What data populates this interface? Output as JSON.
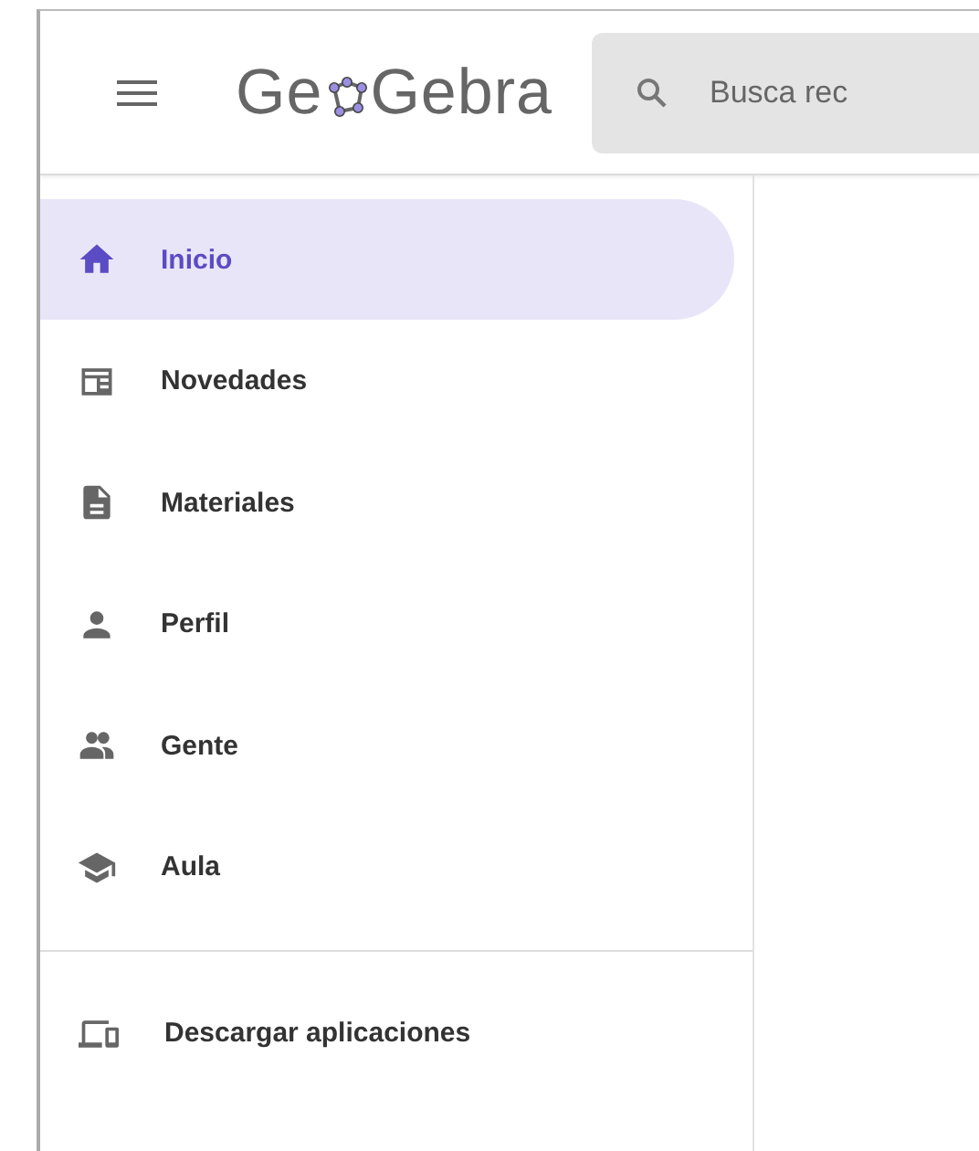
{
  "header": {
    "logo": {
      "before": "Ge",
      "after": "Gebra"
    },
    "search": {
      "placeholder": "Busca rec"
    }
  },
  "sidebar": {
    "items": [
      {
        "kind": "home",
        "label": "Inicio",
        "selected": true
      },
      {
        "kind": "news",
        "label": "Novedades",
        "selected": false
      },
      {
        "kind": "document",
        "label": "Materiales",
        "selected": false
      },
      {
        "kind": "person",
        "label": "Perfil",
        "selected": false
      },
      {
        "kind": "people",
        "label": "Gente",
        "selected": false
      },
      {
        "kind": "school",
        "label": "Aula",
        "selected": false
      }
    ],
    "footer_items": [
      {
        "kind": "devices",
        "label": "Descargar aplicaciones",
        "selected": false
      }
    ]
  }
}
